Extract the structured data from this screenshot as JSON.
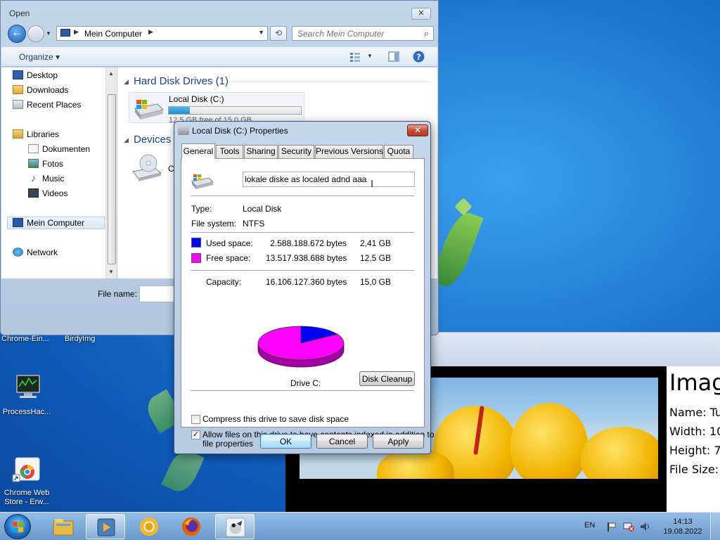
{
  "open_dialog": {
    "title": "Open",
    "address": "Mein Computer",
    "search_placeholder": "Search Mein Computer",
    "organize_label": "Organize ▾",
    "nav": [
      {
        "label": "Desktop"
      },
      {
        "label": "Downloads"
      },
      {
        "label": "Recent Places"
      },
      {
        "label": "Libraries"
      },
      {
        "label": "Dokumenten"
      },
      {
        "label": "Fotos"
      },
      {
        "label": "Music"
      },
      {
        "label": "Videos"
      },
      {
        "label": "Mein Computer"
      },
      {
        "label": "Network"
      }
    ],
    "group_hdd": "Hard Disk Drives (1)",
    "group_devices": "Devices w",
    "drive_name": "Local Disk (C:)",
    "drive_free_text": "12,5 GB free of 15,0 GB",
    "drive_used_fraction": 0.16,
    "cd_letter": "C",
    "file_name_label": "File name:"
  },
  "props": {
    "title": "Local Disk (C:) Properties",
    "close_glyph": "✕",
    "tabs": [
      "General",
      "Tools",
      "Sharing",
      "Security",
      "Previous Versions",
      "Quota"
    ],
    "volume_label": "lokale diske as localed adnd aaa",
    "type_label": "Type:",
    "type_value": "Local Disk",
    "fs_label": "File system:",
    "fs_value": "NTFS",
    "used_label": "Used space:",
    "used_bytes": "2.588.188.672 bytes",
    "used_gb": "2,41 GB",
    "free_label": "Free space:",
    "free_bytes": "13.517.938.688 bytes",
    "free_gb": "12,5 GB",
    "capacity_label": "Capacity:",
    "capacity_bytes": "16.106.127.360 bytes",
    "capacity_gb": "15,0 GB",
    "drive_caption": "Drive C:",
    "cleanup_label": "Disk Cleanup",
    "compress_label": "Compress this drive to save disk space",
    "compress_checked": false,
    "index_label_1": "Allow files on this drive to have contents indexed in addition to",
    "index_label_2": "file properties",
    "index_checked": true,
    "check_glyph": "✓",
    "ok_label": "OK",
    "cancel_label": "Cancel",
    "apply_label": "Apply",
    "used_color": "#0000ff",
    "free_color": "#ff00ff"
  },
  "chart_data": {
    "type": "pie",
    "categories": [
      "Used space",
      "Free space"
    ],
    "values": [
      2588188672,
      13517938688
    ],
    "colors": [
      "#0000ff",
      "#ff00ff"
    ],
    "title": "Drive C:"
  },
  "desktop": {
    "icons": [
      {
        "label": "Chrome-Ein..."
      },
      {
        "label": "BirdyImg"
      },
      {
        "label": "ProcessHac..."
      },
      {
        "label": "Chrome Web\nStore - Erw..."
      }
    ]
  },
  "viewer": {
    "heading": "Imag",
    "name": "Name: Tu",
    "width": "Width: 10",
    "height": "Height: 7",
    "size": "File Size:"
  },
  "taskbar": {
    "lang": "EN",
    "time": "14:13",
    "date": "19.08.2022"
  }
}
